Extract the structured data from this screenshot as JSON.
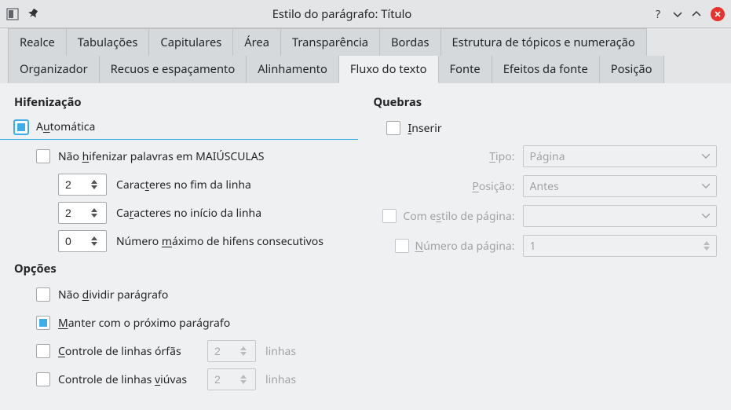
{
  "titlebar": {
    "title": "Estilo do parágrafo: Título"
  },
  "tabs": {
    "row1": [
      "Realce",
      "Tabulações",
      "Capitulares",
      "Área",
      "Transparência",
      "Bordas",
      "Estrutura de tópicos e numeração"
    ],
    "row2": [
      "Organizador",
      "Recuos e espaçamento",
      "Alinhamento",
      "Fluxo do texto",
      "Fonte",
      "Efeitos da fonte",
      "Posição"
    ],
    "active": "Fluxo do texto"
  },
  "hyph": {
    "title": "Hifenização",
    "auto": {
      "label_pre": "A",
      "label_u": "u",
      "label_post": "tomática",
      "checked": true
    },
    "nocaps": {
      "label_pre": "Não ",
      "label_u": "h",
      "label_post": "ifenizar palavras em MAIÚSCULAS",
      "checked": false
    },
    "end": {
      "value": "2",
      "label_pre": "Carac",
      "label_u": "t",
      "label_post": "eres no fim da linha"
    },
    "start": {
      "value": "2",
      "label_pre": "Ca",
      "label_u": "r",
      "label_post": "acteres no início da linha"
    },
    "maxcons": {
      "value": "0",
      "label_pre": "Número ",
      "label_u": "m",
      "label_post": "áximo de hifens consecutivos"
    }
  },
  "breaks": {
    "title": "Quebras",
    "insert": {
      "label_u": "I",
      "label_post": "nserir",
      "checked": false
    },
    "type": {
      "label_u": "T",
      "label_post": "ipo:",
      "value": "Página"
    },
    "position": {
      "label_u": "P",
      "label_post": "osição:",
      "value": "Antes"
    },
    "pagestyle": {
      "label_pre": "Com e",
      "label_u": "s",
      "label_post": "tilo de página:",
      "value": "",
      "checked": false
    },
    "pagenum": {
      "label_u": "N",
      "label_post": "úmero da página:",
      "value": "1",
      "checked": false
    }
  },
  "opts": {
    "title": "Opções",
    "nosplit": {
      "label_pre": "Não ",
      "label_u": "d",
      "label_post": "ividir parágrafo",
      "checked": false
    },
    "keepnext": {
      "label_u": "M",
      "label_post": "anter com o próximo parágrafo",
      "checked": true
    },
    "orphan": {
      "label_u": "C",
      "label_post": "ontrole de linhas órfãs",
      "checked": false,
      "value": "2",
      "unit": "linhas"
    },
    "widow": {
      "label_pre": "Controle de linhas ",
      "label_u": "v",
      "label_post": "iúvas",
      "checked": false,
      "value": "2",
      "unit": "linhas"
    }
  }
}
